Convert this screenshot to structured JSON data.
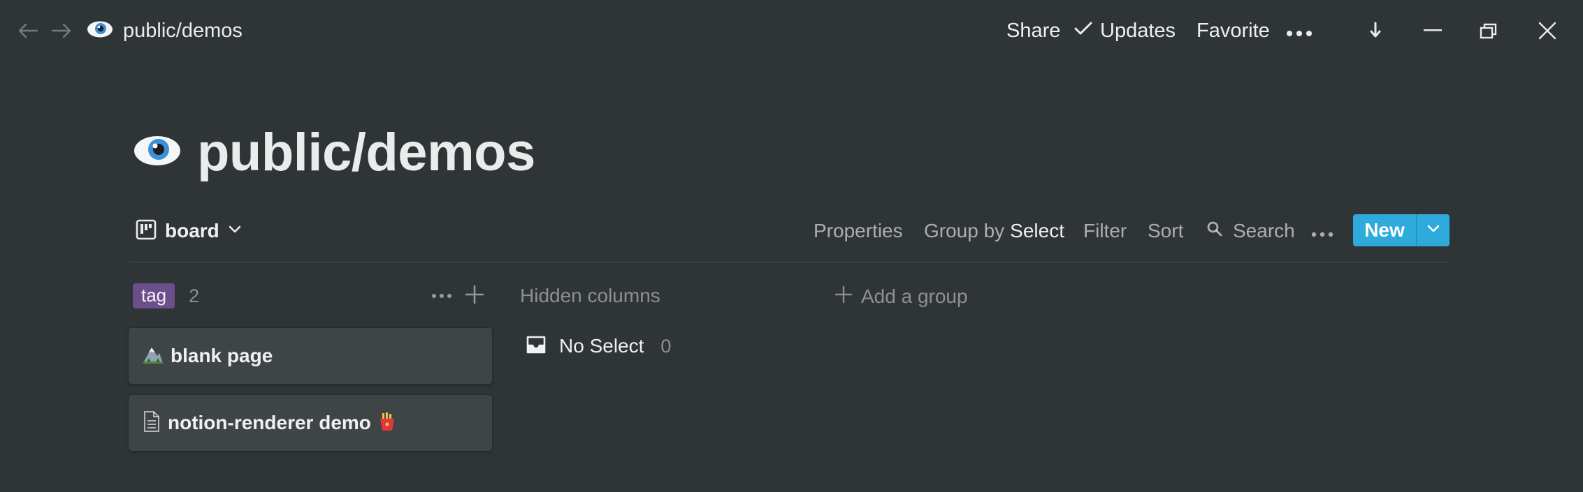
{
  "topbar": {
    "breadcrumb_title": "public/demos",
    "share_label": "Share",
    "updates_label": "Updates",
    "favorite_label": "Favorite"
  },
  "page": {
    "title": "public/demos"
  },
  "view": {
    "label": "board"
  },
  "toolbar": {
    "properties_label": "Properties",
    "group_by_prefix": "Group by",
    "group_by_value": "Select",
    "filter_label": "Filter",
    "sort_label": "Sort",
    "search_label": "Search",
    "new_label": "New",
    "accent_color": "#2eaadc"
  },
  "board": {
    "group": {
      "tag_label": "tag",
      "tag_color": "#6a4f8c",
      "count": "2",
      "cards": [
        {
          "title": "blank page",
          "icon": "mountain-icon"
        },
        {
          "title": "notion-renderer demo",
          "icon": "document-icon",
          "emoji": "fries-icon"
        }
      ]
    },
    "hidden_columns_label": "Hidden columns",
    "no_select_label": "No Select",
    "no_select_count": "0",
    "add_group_label": "Add a group"
  }
}
